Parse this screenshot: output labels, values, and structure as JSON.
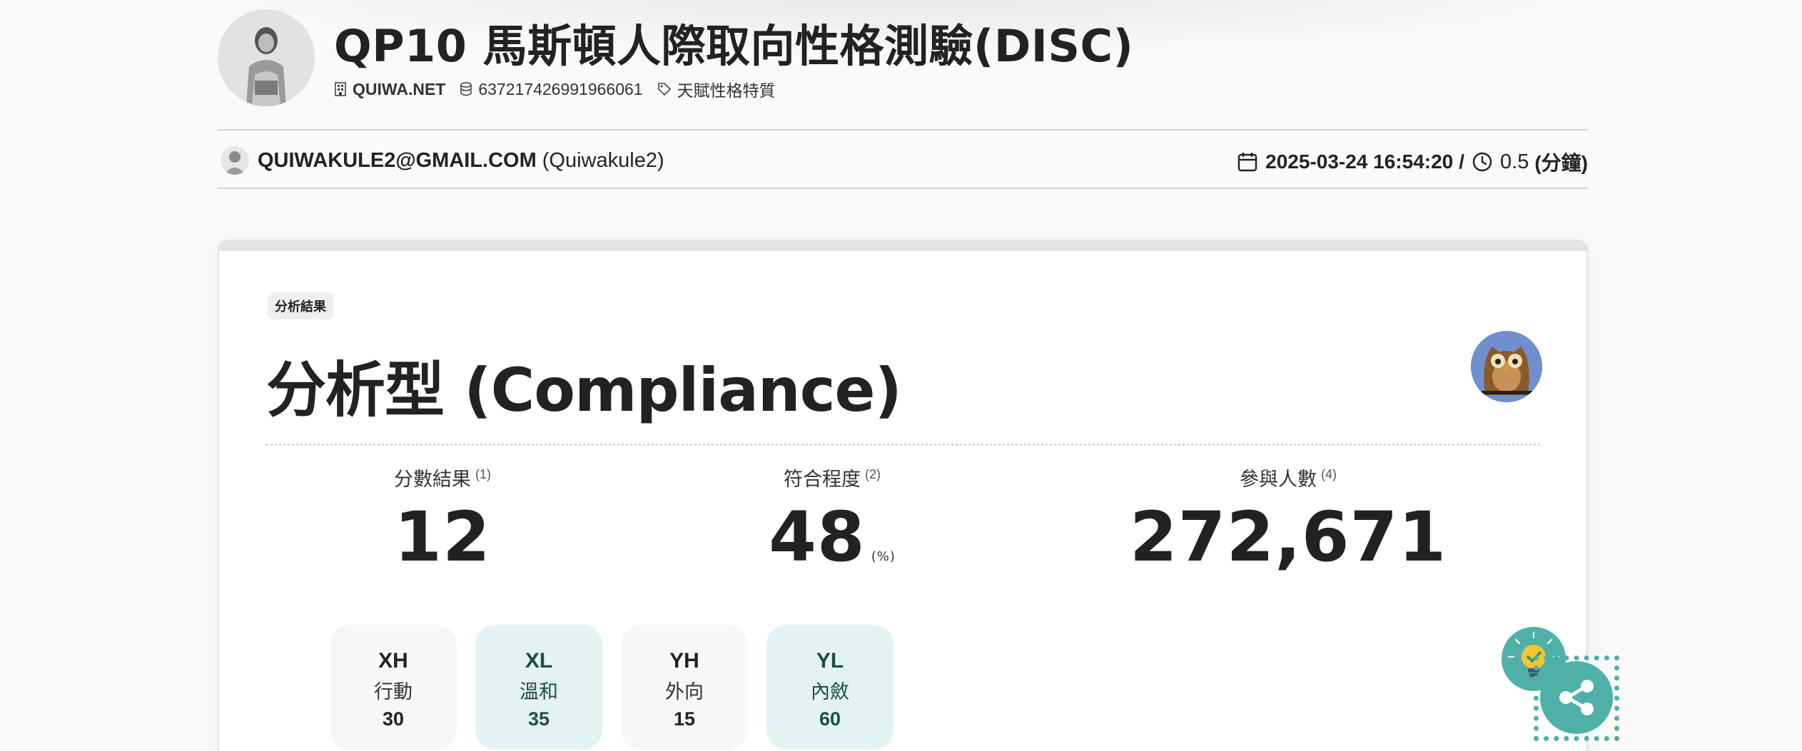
{
  "header": {
    "title": "QP10 馬斯頓人際取向性格測驗(DISC)",
    "site": "QUIWA.NET",
    "test_id": "637217426991966061",
    "category": "天賦性格特質"
  },
  "user": {
    "email": "QUIWAKULE2@GMAIL.COM",
    "nickname": "(Quiwakule2)",
    "datetime": "2025-03-24 16:54:20",
    "separator": "/",
    "duration": "0.5",
    "duration_unit": "(分鐘)"
  },
  "result": {
    "badge": "分析結果",
    "title": "分析型 (Compliance)",
    "stats": [
      {
        "label": "分數結果",
        "note": "(1)",
        "value": "12",
        "unit": ""
      },
      {
        "label": "符合程度",
        "note": "(2)",
        "value": "48",
        "unit": "(%)"
      },
      {
        "label": "參與人數",
        "note": "(4)",
        "value": "272,671",
        "unit": ""
      }
    ],
    "dimensions": [
      {
        "code": "XH",
        "name": "行動",
        "score": "30",
        "highlight": false
      },
      {
        "code": "XL",
        "name": "溫和",
        "score": "35",
        "highlight": true
      },
      {
        "code": "YH",
        "name": "外向",
        "score": "15",
        "highlight": false
      },
      {
        "code": "YL",
        "name": "內斂",
        "score": "60",
        "highlight": true
      }
    ]
  },
  "icons": {
    "site": "building-icon",
    "id": "database-icon",
    "category": "tag-icon",
    "date": "calendar-icon",
    "duration": "clock-icon",
    "bulb": "lightbulb-icon",
    "share": "share-icon"
  },
  "colors": {
    "accent": "#4fb0a8",
    "highlight_tile": "#e3f3f2",
    "owl_bg": "#6f8fcf"
  }
}
